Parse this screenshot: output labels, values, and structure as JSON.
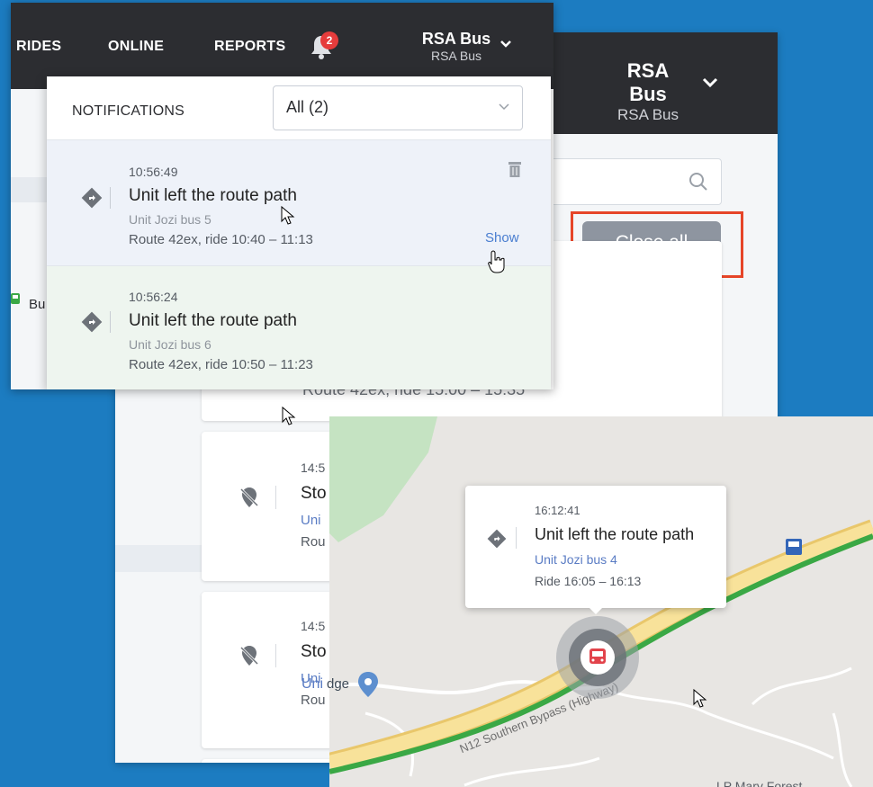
{
  "back_panel": {
    "account": {
      "name": "RSA Bus",
      "sub": "RSA Bus"
    },
    "close_all_label": "Close all",
    "partial_route_text": "Route 42ex, ride 15:00 – 15:35",
    "cards": [
      {
        "time": "14:5",
        "title": "Sto",
        "unit": "Uni",
        "route": "Rou"
      },
      {
        "time": "14:5",
        "title": "Sto",
        "unit": "Uni",
        "route": "Rou"
      }
    ]
  },
  "front_panel": {
    "nav": {
      "rides": "RIDES",
      "online": "ONLINE",
      "reports": "REPORTS"
    },
    "bell_badge": "2",
    "account": {
      "name": "RSA Bus",
      "sub": "RSA Bus"
    },
    "left_strip_text": "Bu",
    "notifications": {
      "title": "NOTIFICATIONS",
      "filter_value": "All (2)",
      "items": [
        {
          "time": "10:56:49",
          "title": "Unit left the route path",
          "unit": "Unit Jozi bus 5",
          "route": "Route 42ex, ride 10:40 – 11:13",
          "action": "Show"
        },
        {
          "time": "10:56:24",
          "title": "Unit left the route path",
          "unit": "Unit Jozi bus 6",
          "route": "Route 42ex, ride 10:50 – 11:23"
        }
      ]
    }
  },
  "map_panel": {
    "popup": {
      "time": "16:12:41",
      "title": "Unit left the route path",
      "unit": "Unit Jozi bus 4",
      "ride": "Ride 16:05 – 16:13"
    },
    "road_label": "N12 Southern Bypass (Highway)",
    "partial_bottom_label": "LP Mary Forest",
    "partial_unit_text": "Uni",
    "partial_ridge_text": "dge"
  },
  "colors": {
    "background": "#1c7cc1",
    "header": "#2c2d31",
    "highlight": "#e64528",
    "route_green": "#3aa845",
    "road_yellow": "#f5d97a",
    "bus_red": "#e2434b",
    "link_blue": "#4a7ed0"
  }
}
